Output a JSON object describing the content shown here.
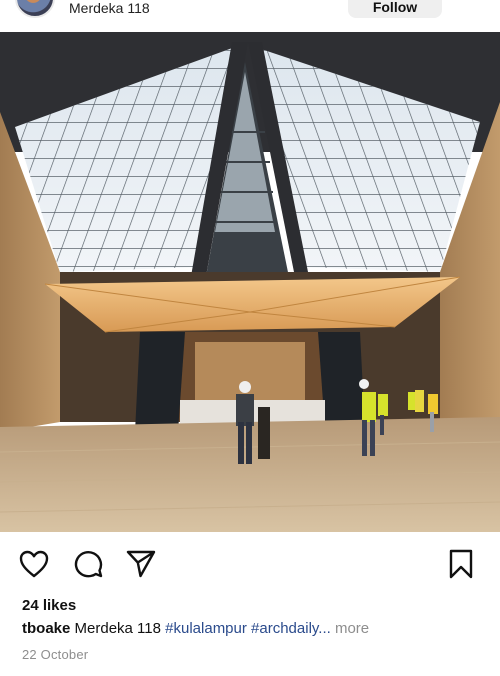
{
  "post": {
    "location": "Merdeka 118",
    "follow_label": "Follow",
    "likes_text": "24 likes",
    "caption": {
      "username": "tboake",
      "text": "Merdeka 118",
      "hashtags": "#kulalampur #archdaily...",
      "more_label": "more"
    },
    "date": "22 October"
  },
  "icons": {
    "like": "heart-icon",
    "comment": "comment-icon",
    "share": "send-icon",
    "save": "bookmark-icon"
  },
  "colors": {
    "hashtag": "#2b4b8c",
    "muted": "#8e8e8e",
    "follow_bg": "#efefef"
  }
}
